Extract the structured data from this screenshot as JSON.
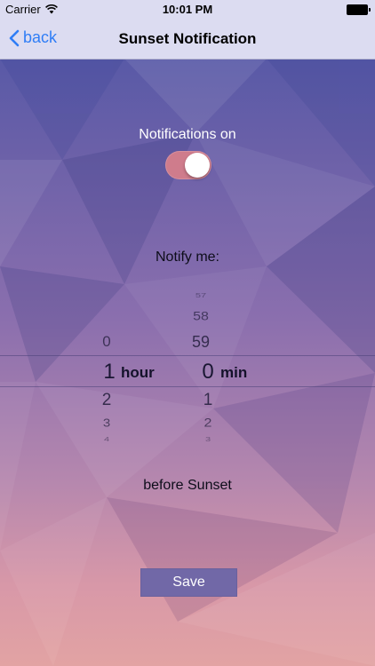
{
  "status_bar": {
    "carrier": "Carrier",
    "time": "10:01 PM"
  },
  "nav": {
    "back_label": "back",
    "title": "Sunset Notification"
  },
  "notifications": {
    "label": "Notifications on",
    "enabled": true
  },
  "notify_label": "Notify me:",
  "picker": {
    "hours_column": [
      "0",
      "1",
      "2",
      "3",
      "4"
    ],
    "hours_selected": "1",
    "hours_unit": "hour",
    "minutes_column": [
      "57",
      "58",
      "59",
      "0",
      "1",
      "2",
      "3"
    ],
    "minutes_selected": "0",
    "minutes_unit": "min"
  },
  "before_label": "before Sunset",
  "save_label": "Save",
  "colors": {
    "accent_blue": "#2f7df6",
    "toggle_on": "#cf7c8c",
    "save_button": "#7168a7"
  }
}
